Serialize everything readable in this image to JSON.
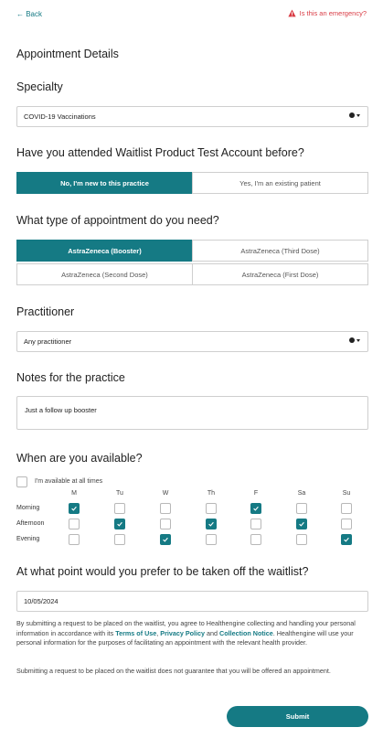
{
  "header": {
    "back_label": "← Back",
    "emergency_label": "Is this an emergency?"
  },
  "page_title": "Appointment Details",
  "specialty": {
    "heading": "Specialty",
    "selected": "COVID-19 Vaccinations"
  },
  "attended": {
    "question": "Have you attended Waitlist Product Test Account before?",
    "options": [
      "No, I'm new to this practice",
      "Yes, I'm an existing patient"
    ],
    "selected_index": 0
  },
  "appointment_type": {
    "question": "What type of appointment do you need?",
    "options": [
      "AstraZeneca (Booster)",
      "AstraZeneca (Third Dose)",
      "AstraZeneca (Second Dose)",
      "AstraZeneca (First Dose)"
    ],
    "selected_index": 0
  },
  "practitioner": {
    "heading": "Practitioner",
    "selected": "Any practitioner"
  },
  "notes": {
    "heading": "Notes for the practice",
    "value": "Just a follow up booster"
  },
  "availability": {
    "heading": "When are you available?",
    "all_times_label": "I'm available at all times",
    "all_times_checked": false,
    "days": [
      "M",
      "Tu",
      "W",
      "Th",
      "F",
      "Sa",
      "Su"
    ],
    "slots": [
      {
        "label": "Morning",
        "checked": [
          true,
          false,
          false,
          false,
          true,
          false,
          false
        ]
      },
      {
        "label": "Afternoon",
        "checked": [
          false,
          true,
          false,
          true,
          false,
          true,
          false
        ]
      },
      {
        "label": "Evening",
        "checked": [
          false,
          false,
          true,
          false,
          false,
          false,
          true
        ]
      }
    ]
  },
  "removal": {
    "question": "At what point would you prefer to be taken off the waitlist?",
    "date_value": "10/05/2024"
  },
  "legal": {
    "p1_a": "By submitting a request to be placed on the waitlist, you agree to Healthengine collecting and handling your personal information in accordance with its ",
    "terms": "Terms of Use",
    "sep1": ", ",
    "privacy": "Privacy Policy",
    "sep2": " and ",
    "collection": "Collection Notice",
    "p1_b": ". Healthengine will use your personal information for the purposes of facilitating an appointment with the relevant health provider.",
    "p2": "Submitting a request to be placed on the waitlist does not guarantee that you will be offered an appointment."
  },
  "submit_label": "Submit",
  "colors": {
    "accent": "#157a84",
    "emergency": "#d93c45"
  }
}
